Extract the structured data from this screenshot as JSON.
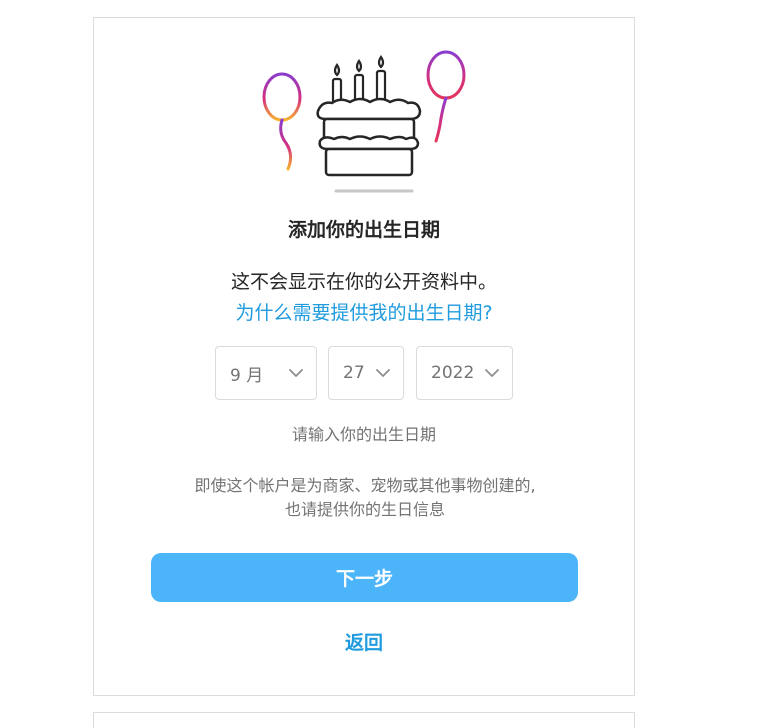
{
  "dialog": {
    "title": "添加你的出生日期",
    "subtitle": "这不会显示在你的公开资料中。",
    "why_link": "为什么需要提供我的出生日期?",
    "hint": "请输入你的出生日期",
    "note_line1": "即使这个帐户是为商家、宠物或其他事物创建的,",
    "note_line2": "也请提供你的生日信息",
    "next_label": "下一步",
    "back_label": "返回"
  },
  "birthday": {
    "month": "9 月",
    "day": "27",
    "year": "2022"
  },
  "icons": {
    "illustration": "birthday-cake-with-balloons",
    "select_arrow": "chevron-down"
  },
  "colors": {
    "primary_blue": "#4cb5f9",
    "link_blue": "#1f9bde",
    "text_dark": "#262626",
    "text_muted": "#737373",
    "border": "#dbdbdb"
  }
}
